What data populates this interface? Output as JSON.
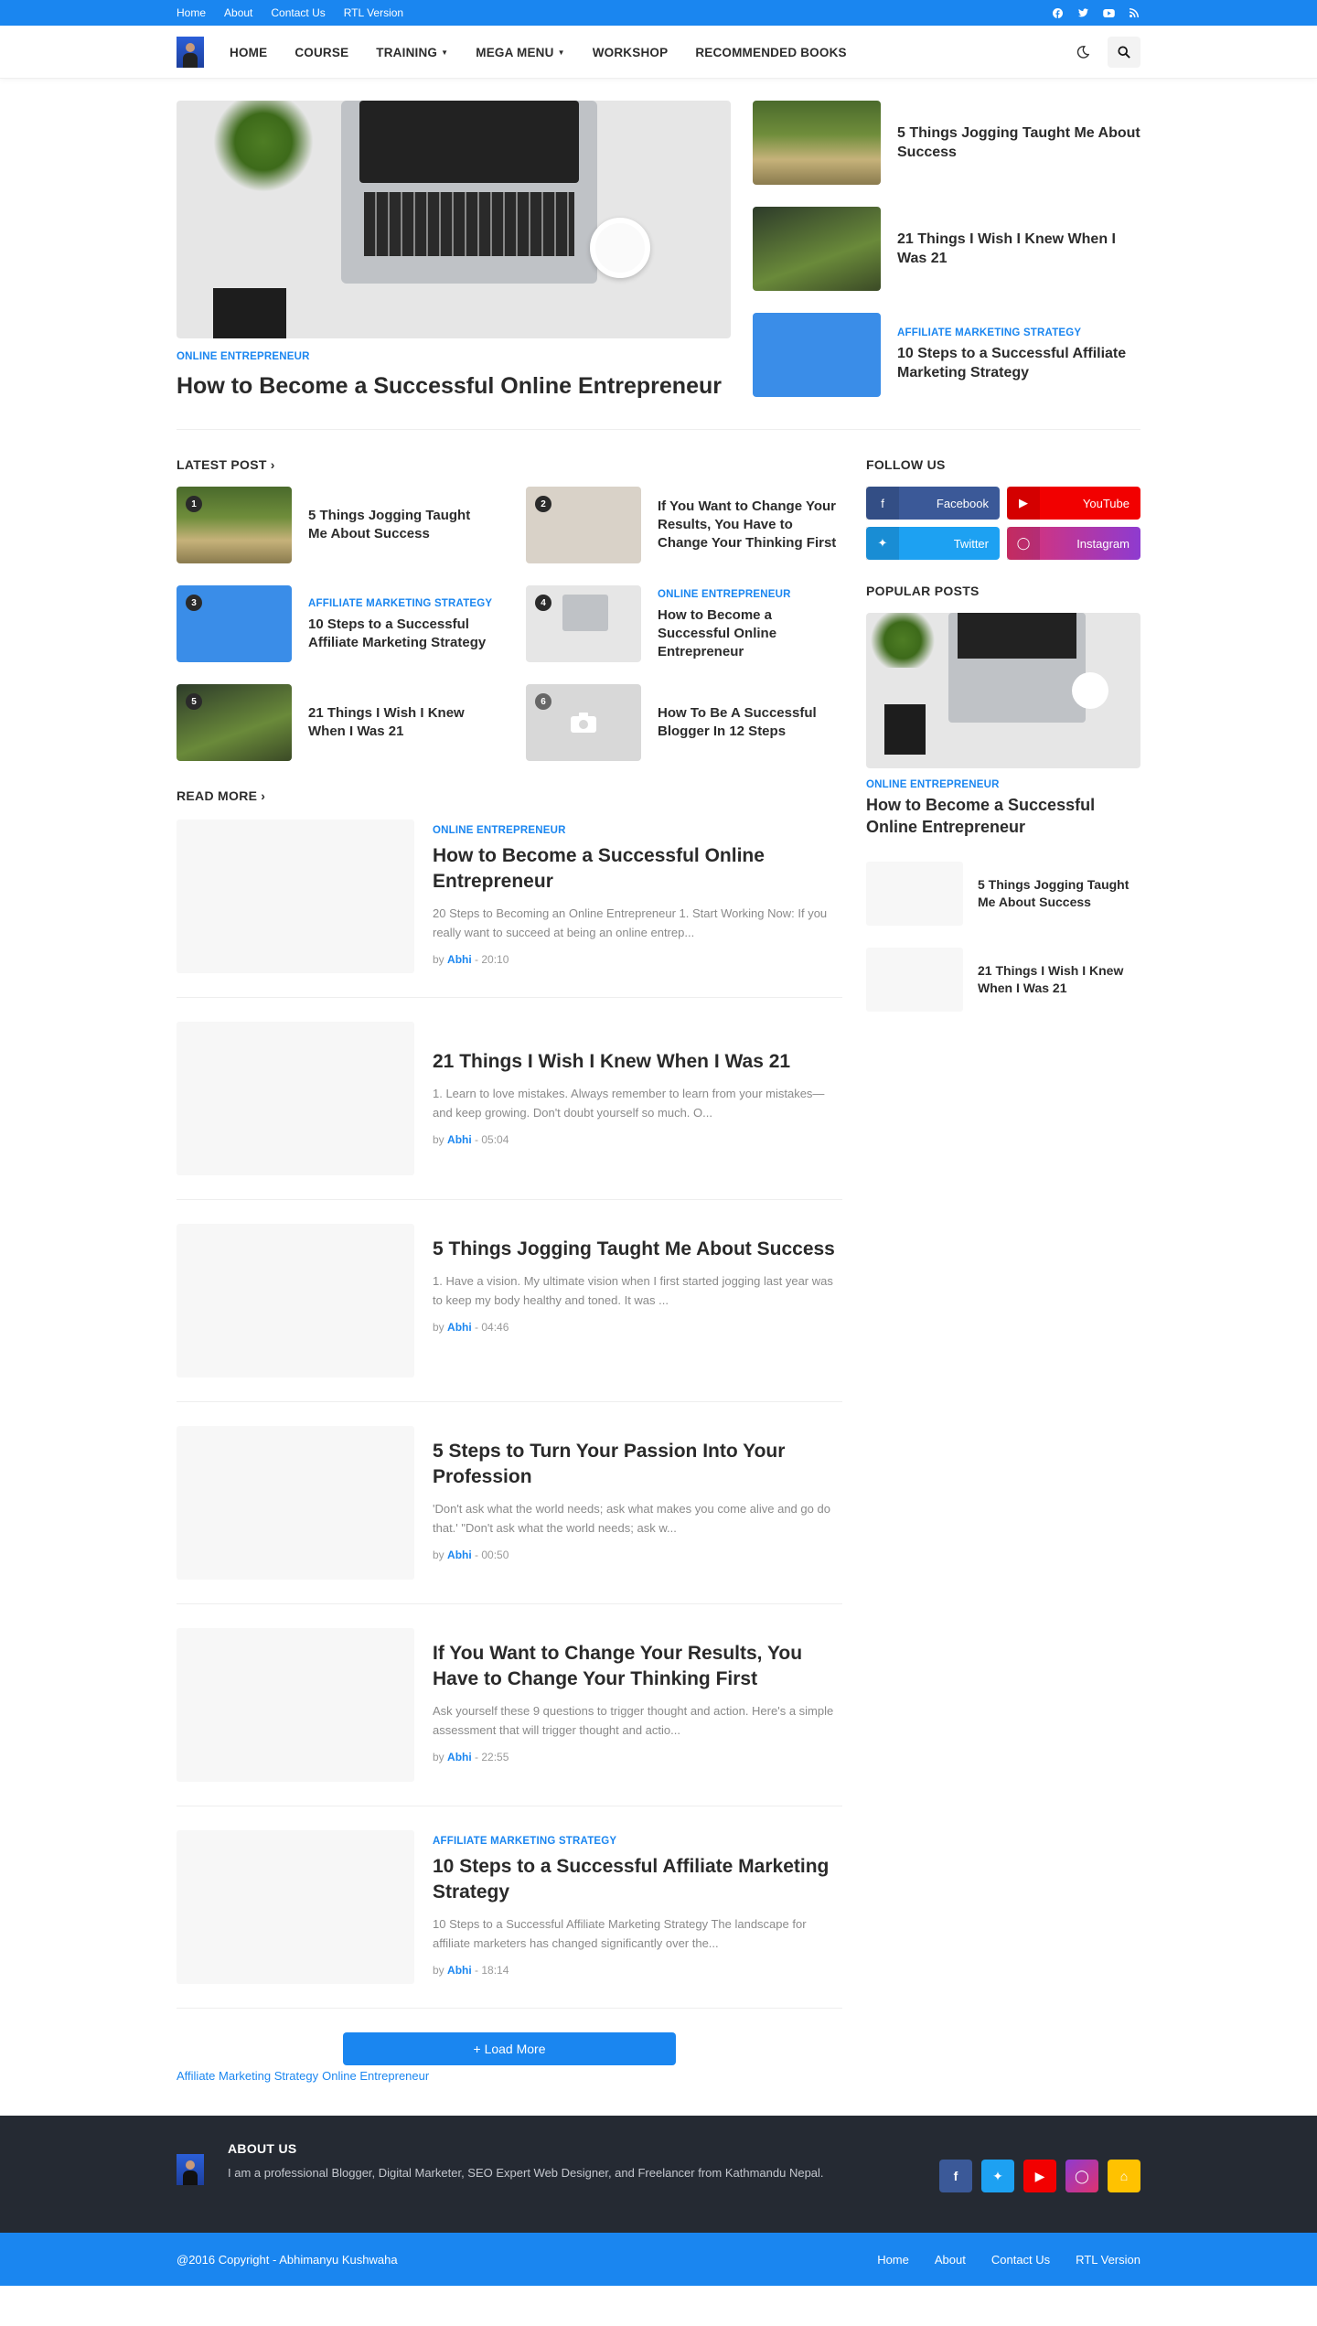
{
  "topbar": {
    "links": [
      "Home",
      "About",
      "Contact Us",
      "RTL Version"
    ],
    "social_icons": [
      "facebook-icon",
      "twitter-icon",
      "youtube-icon",
      "rss-icon"
    ]
  },
  "nav": {
    "items": [
      {
        "label": "HOME"
      },
      {
        "label": "COURSE"
      },
      {
        "label": "TRAINING",
        "dropdown": true
      },
      {
        "label": "MEGA MENU",
        "dropdown": true
      },
      {
        "label": "WORKSHOP"
      },
      {
        "label": "RECOMMENDED BOOKS"
      }
    ]
  },
  "hero": {
    "main": {
      "category": "ONLINE ENTREPRENEUR",
      "title": "How to Become a Successful Online Entrepreneur"
    },
    "side": [
      {
        "category": "",
        "title": "5 Things Jogging Taught Me About Success"
      },
      {
        "category": "",
        "title": "21 Things I Wish I Knew When I Was 21"
      },
      {
        "category": "AFFILIATE MARKETING STRATEGY",
        "title": "10 Steps to a Successful Affiliate Marketing Strategy"
      }
    ]
  },
  "latest": {
    "heading": "LATEST POST",
    "posts": [
      {
        "num": "1",
        "category": "",
        "title": "5 Things Jogging Taught Me About Success"
      },
      {
        "num": "2",
        "category": "",
        "title": "If You Want to Change Your Results, You Have to Change Your Thinking First"
      },
      {
        "num": "3",
        "category": "AFFILIATE MARKETING STRATEGY",
        "title": "10 Steps to a Successful Affiliate Marketing Strategy"
      },
      {
        "num": "4",
        "category": "ONLINE ENTREPRENEUR",
        "title": "How to Become a Successful Online Entrepreneur"
      },
      {
        "num": "5",
        "category": "",
        "title": "21 Things I Wish I Knew When I Was 21"
      },
      {
        "num": "6",
        "category": "",
        "title": "How To Be A Successful Blogger In 12 Steps"
      }
    ]
  },
  "readmore": {
    "heading": "READ MORE",
    "posts": [
      {
        "category": "ONLINE ENTREPRENEUR",
        "title": "How to Become a Successful Online Entrepreneur",
        "excerpt": "20 Steps to Becoming an Online Entrepreneur 1.   Start Working Now:  If you really want to succeed at being an online entrep...",
        "by": "by",
        "author": "Abhi",
        "time": " - 20:10"
      },
      {
        "category": "",
        "title": "21 Things I Wish I Knew When I Was 21",
        "excerpt": "1. Learn to love mistakes. Always remember to learn from your mistakes—and keep growing. Don't doubt yourself so much. O...",
        "by": "by",
        "author": "Abhi",
        "time": " - 05:04"
      },
      {
        "category": "",
        "title": "5 Things Jogging Taught Me About Success",
        "excerpt": "1. Have a vision. My ultimate vision when I first started jogging last year was to keep my body healthy and toned. It was ...",
        "by": "by",
        "author": "Abhi",
        "time": " - 04:46"
      },
      {
        "category": "",
        "title": "5 Steps to Turn Your Passion Into Your Profession",
        "excerpt": "'Don't ask what the world needs; ask what makes you come alive and go do that.'  \"Don't ask what the world needs; ask w...",
        "by": "by",
        "author": "Abhi",
        "time": " - 00:50"
      },
      {
        "category": "",
        "title": "If You Want to Change Your Results, You Have to Change Your Thinking First",
        "excerpt": "Ask yourself these 9 questions to trigger thought and action.  Here's a simple assessment that will trigger thought and actio...",
        "by": "by",
        "author": "Abhi",
        "time": " - 22:55"
      },
      {
        "category": "AFFILIATE MARKETING STRATEGY",
        "title": "10 Steps to a Successful Affiliate Marketing Strategy",
        "excerpt": "10 Steps to a Successful Affiliate Marketing Strategy The landscape for affiliate marketers has changed significantly over the...",
        "by": "by",
        "author": "Abhi",
        "time": " - 18:14"
      }
    ],
    "load_more": "+ Load More",
    "labels": [
      "Affiliate Marketing Strategy",
      "Online Entrepreneur"
    ]
  },
  "sidebar": {
    "follow_heading": "FOLLOW US",
    "follow": [
      {
        "label": "Facebook",
        "color": "#3b5998",
        "icon": "facebook-icon"
      },
      {
        "label": "YouTube",
        "color": "#f20000",
        "icon": "youtube-icon"
      },
      {
        "label": "Twitter",
        "color": "#1da1f2",
        "icon": "twitter-icon"
      },
      {
        "label": "Instagram",
        "color": "#d6306e",
        "icon": "instagram-icon"
      }
    ],
    "popular_heading": "POPULAR POSTS",
    "popular_main": {
      "category": "ONLINE ENTREPRENEUR",
      "title": "How to Become a Successful Online Entrepreneur"
    },
    "popular_small": [
      {
        "title": "5 Things Jogging Taught Me About Success"
      },
      {
        "title": "21 Things I Wish I Knew When I Was 21"
      }
    ]
  },
  "footer": {
    "about_heading": "ABOUT US",
    "about_text": "I am a professional Blogger, Digital Marketer, SEO Expert Web Designer, and Freelancer from Kathmandu Nepal.",
    "social": [
      {
        "name": "facebook-icon",
        "color": "#3b5998"
      },
      {
        "name": "twitter-icon",
        "color": "#1da1f2"
      },
      {
        "name": "youtube-icon",
        "color": "#f20000"
      },
      {
        "name": "instagram-icon",
        "color": "#c13584"
      },
      {
        "name": "rss-icon",
        "color": "#ffc200"
      }
    ],
    "copyright": "@2016 Copyright - Abhimanyu Kushwaha",
    "links": [
      "Home",
      "About",
      "Contact Us",
      "RTL Version"
    ]
  },
  "colors": {
    "accent": "#1a86f0",
    "footer": "#252a33"
  }
}
